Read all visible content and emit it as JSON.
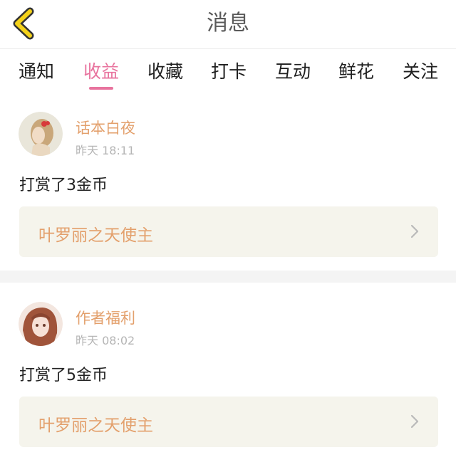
{
  "header": {
    "title": "消息"
  },
  "tabs": [
    {
      "label": "通知",
      "active": false
    },
    {
      "label": "收益",
      "active": true
    },
    {
      "label": "收藏",
      "active": false
    },
    {
      "label": "打卡",
      "active": false
    },
    {
      "label": "互动",
      "active": false
    },
    {
      "label": "鲜花",
      "active": false
    },
    {
      "label": "关注",
      "active": false
    }
  ],
  "colors": {
    "accent": "#e8739e",
    "username": "#e3a06c",
    "link_box_bg": "#f5f4ec"
  },
  "messages": [
    {
      "username": "话本白夜",
      "time": "昨天 18:11",
      "text": "打赏了3金币",
      "book": "叶罗丽之天使主"
    },
    {
      "username": "作者福利",
      "time": "昨天 08:02",
      "text": "打赏了5金币",
      "book": "叶罗丽之天使主"
    }
  ]
}
